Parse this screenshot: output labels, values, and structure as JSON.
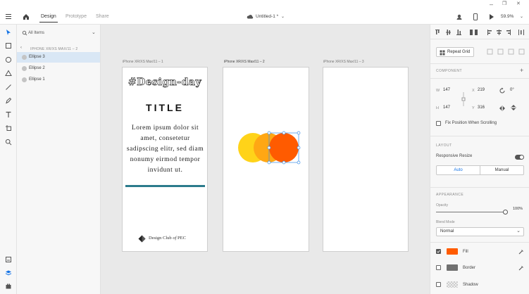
{
  "window": {
    "min_glyph": "–",
    "restore_glyph": "❐",
    "close_glyph": "✕"
  },
  "toolbar": {
    "tabs": [
      {
        "label": "Design",
        "active": true
      },
      {
        "label": "Prototype",
        "active": false
      },
      {
        "label": "Share",
        "active": false
      }
    ],
    "doc_title": "Untitled-1 *",
    "zoom": "59.9%"
  },
  "layers": {
    "filter_label": "All Items",
    "breadcrumb": "IPHONE XR/XS MAX/11 – 2",
    "items": [
      {
        "label": "Ellipse 3",
        "selected": true
      },
      {
        "label": "Ellipse 2",
        "selected": false
      },
      {
        "label": "Ellipse 1",
        "selected": false
      }
    ]
  },
  "canvas": {
    "artboards": [
      {
        "label": "iPhone XR/XS Max/11 – 1"
      },
      {
        "label": "iPhone XR/XS Max/11 – 2"
      },
      {
        "label": "iPhone XR/XS Max/11 – 3"
      }
    ],
    "poster": {
      "heading": "#Design-day",
      "title": "TITLE",
      "body": "Lorem ipsum dolor sit amet, consetetur sadipscing elitr, sed diam nonumy eirmod tempor invidunt ut.",
      "footer_brand": "Design Club",
      "footer_of": "of",
      "footer_org": "PEC"
    },
    "colors": {
      "circle_yellow": "#ffd319",
      "circle_amber": "#ffa714",
      "circle_orange": "#ff5b00",
      "teal_bar": "#2c7b8c",
      "selection": "#3a8ee6"
    }
  },
  "props": {
    "repeat_grid_label": "Repeat Grid",
    "component_title": "COMPONENT",
    "w_label": "W",
    "w_value": "147",
    "h_label": "H",
    "h_value": "147",
    "x_label": "X",
    "x_value": "219",
    "y_label": "Y",
    "y_value": "316",
    "rotation_value": "0°",
    "fix_position_label": "Fix Position When Scrolling",
    "layout_title": "LAYOUT",
    "responsive_label": "Responsive Resize",
    "auto_label": "Auto",
    "manual_label": "Manual",
    "appearance_title": "APPEARANCE",
    "opacity_label": "Opacity",
    "opacity_value": "100%",
    "opacity_fraction": 1.0,
    "blend_label": "Blend Mode",
    "blend_value": "Normal",
    "fill_label": "Fill",
    "fill_color": "#ff5b00",
    "border_label": "Border",
    "border_color": "#707070",
    "shadow_label": "Shadow"
  }
}
